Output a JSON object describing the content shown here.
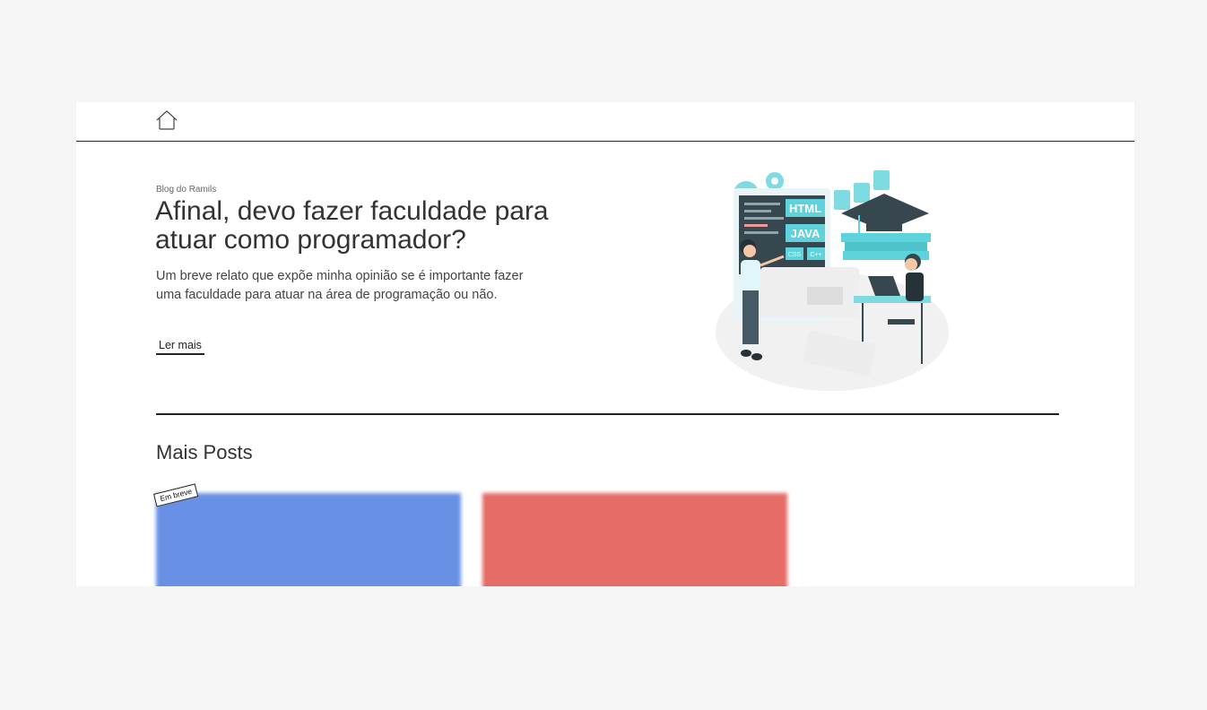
{
  "nav": {
    "home_icon": "home-icon"
  },
  "hero": {
    "eyebrow": "Blog do Ramils",
    "title": "Afinal, devo fazer faculdade para atuar como programador?",
    "description": "Um breve relato que expõe minha opinião se é importante fazer uma faculdade para atuar na área de programação ou não.",
    "read_more": "Ler mais",
    "illustration": {
      "code_labels": [
        "HTML",
        "JAVA",
        "CSS",
        "C++"
      ]
    }
  },
  "posts": {
    "section_title": "Mais Posts",
    "cards": [
      {
        "badge": "Em breve",
        "color": "#6891e6"
      },
      {
        "color": "#e66c66"
      }
    ]
  },
  "colors": {
    "background": "#f5f5f5",
    "surface": "#ffffff",
    "text": "#333333",
    "accent_teal": "#5fd3dc",
    "accent_dark": "#37474f"
  }
}
